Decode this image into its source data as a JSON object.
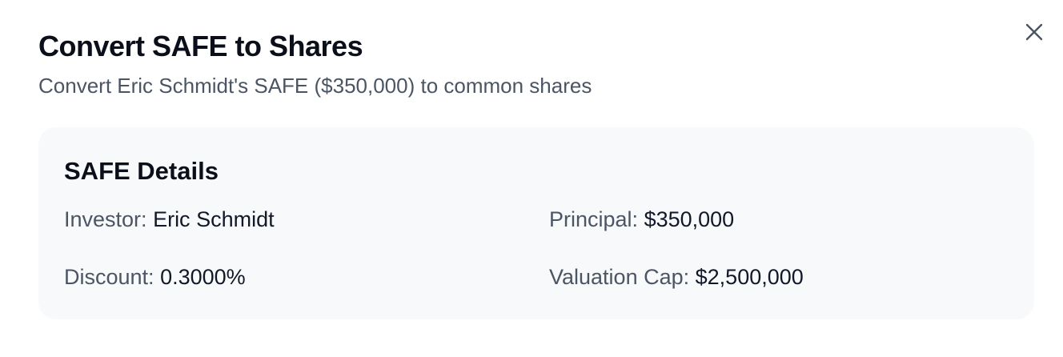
{
  "dialog": {
    "title": "Convert SAFE to Shares",
    "subtitle": "Convert Eric Schmidt's SAFE ($350,000) to common shares",
    "close_icon": "close-icon"
  },
  "details": {
    "heading": "SAFE Details",
    "investor_label": "Investor:",
    "investor_value": "Eric Schmidt",
    "principal_label": "Principal:",
    "principal_value": "$350,000",
    "discount_label": "Discount:",
    "discount_value": "0.3000%",
    "valuation_cap_label": "Valuation Cap:",
    "valuation_cap_value": "$2,500,000"
  },
  "colors": {
    "title": "#0b0f19",
    "muted_text": "#4b5563",
    "card_background": "#f8f9fb"
  }
}
